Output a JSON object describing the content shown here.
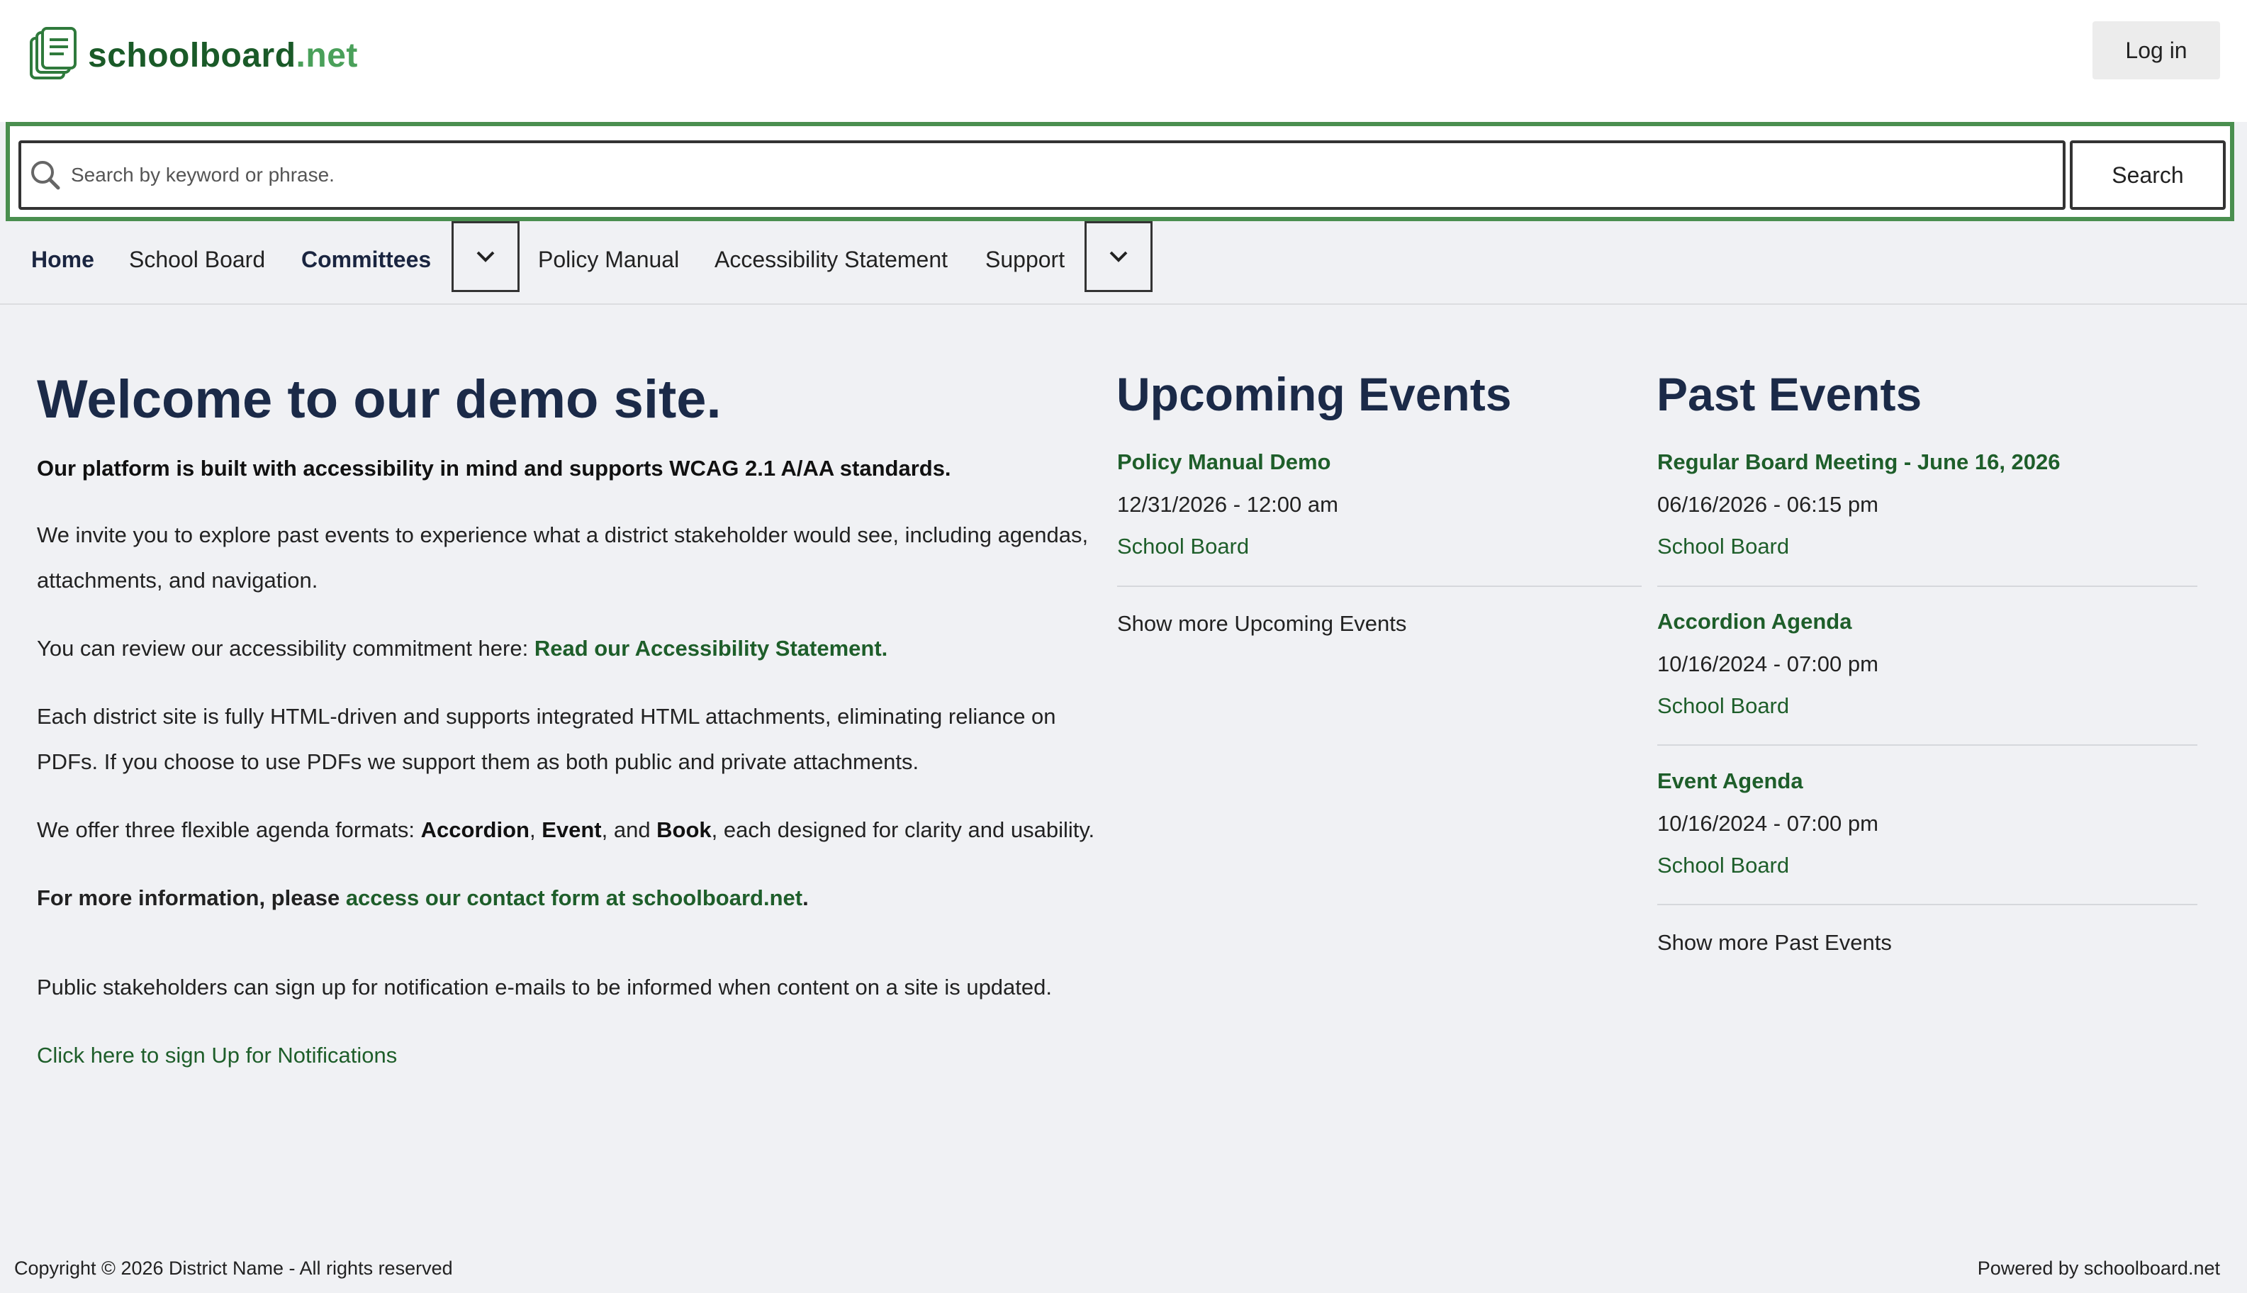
{
  "header": {
    "logo_text_main": "schoolboard",
    "logo_text_suffix": ".net",
    "login_label": "Log in"
  },
  "search": {
    "placeholder": "Search by keyword or phrase.",
    "button_label": "Search"
  },
  "nav": {
    "items": [
      {
        "label": "Home"
      },
      {
        "label": "School Board"
      },
      {
        "label": "Committees"
      },
      {
        "label": "Policy Manual"
      },
      {
        "label": "Accessibility Statement"
      },
      {
        "label": "Support"
      }
    ]
  },
  "main": {
    "title": "Welcome to our demo site.",
    "intro_bold": "Our platform is built with accessibility in mind and supports WCAG 2.1 A/AA standards.",
    "p1": "We invite you to explore past events to experience what a district stakeholder would see, including agendas, attachments, and navigation.",
    "p2_text": "You can review our accessibility commitment here: ",
    "p2_link": "Read our Accessibility Statement.",
    "p3": "Each district site is fully HTML-driven and supports integrated HTML attachments, eliminating reliance on PDFs. If you choose to use PDFs we support them as both public and private attachments.",
    "p4_a": "We offer three flexible agenda formats: ",
    "p4_fmt1": "Accordion",
    "p4_sep1": ", ",
    "p4_fmt2": "Event",
    "p4_sep2": ", and ",
    "p4_fmt3": "Book",
    "p4_b": ", each designed for clarity and usability.",
    "p5_bold": "For more information, please ",
    "p5_link": "access our contact form at schoolboard.net",
    "p5_end": ".",
    "p6": "Public stakeholders can sign up for notification e-mails to be informed when content on a site is updated.",
    "signup_link": "Click here to sign Up for Notifications"
  },
  "upcoming": {
    "heading": "Upcoming Events",
    "events": [
      {
        "title": "Policy Manual Demo",
        "date": "12/31/2026 - 12:00 am",
        "category": "School Board"
      }
    ],
    "more_label": "Show more Upcoming Events"
  },
  "past": {
    "heading": "Past Events",
    "events": [
      {
        "title": "Regular Board Meeting - June 16, 2026",
        "date": "06/16/2026 - 06:15 pm",
        "category": "School Board"
      },
      {
        "title": "Accordion Agenda",
        "date": "10/16/2024 - 07:00 pm",
        "category": "School Board"
      },
      {
        "title": "Event Agenda",
        "date": "10/16/2024 - 07:00 pm",
        "category": "School Board"
      }
    ],
    "more_label": "Show more Past Events"
  },
  "footer": {
    "copyright": "Copyright © 2026 District Name - All rights reserved",
    "powered": "Powered by schoolboard.net"
  },
  "icons": {
    "logo": "document-stack-icon",
    "search": "search-icon",
    "dropdown": "chevron-down-icon"
  },
  "colors": {
    "brand_dark": "#1a5a28",
    "brand_light": "#4aa05a",
    "heading": "#1b2a48",
    "focus_border": "#4a8f4f",
    "background": "#f0f1f4"
  }
}
